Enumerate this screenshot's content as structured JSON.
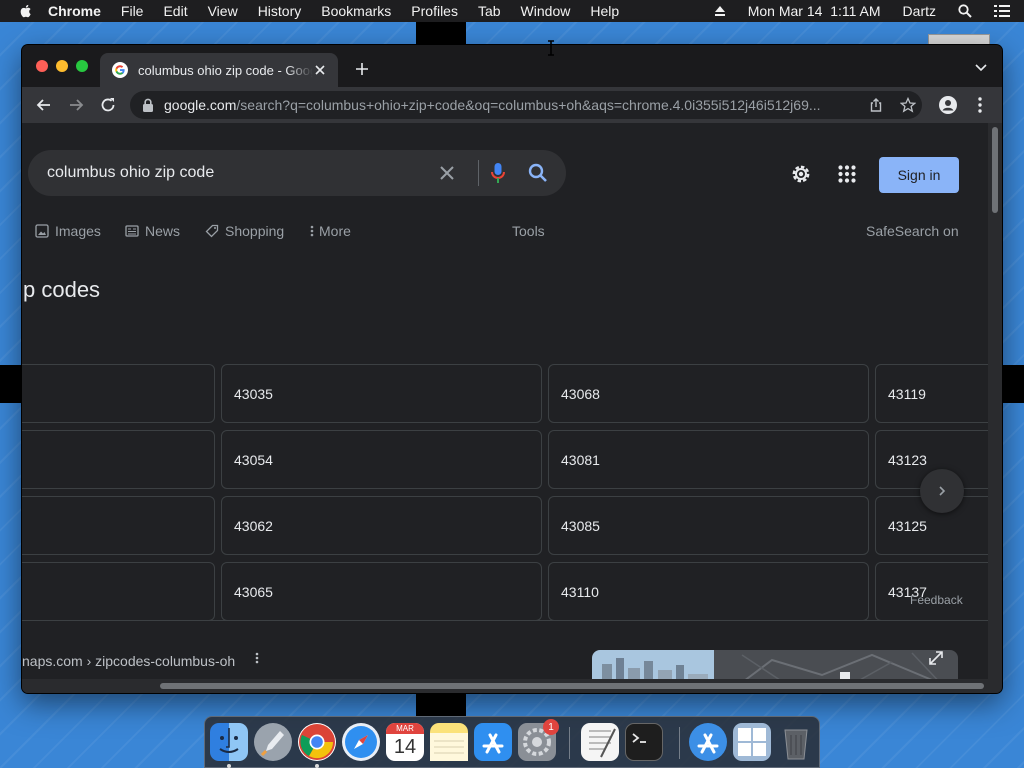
{
  "menubar": {
    "app": "Chrome",
    "items": [
      "File",
      "Edit",
      "View",
      "History",
      "Bookmarks",
      "Profiles",
      "Tab",
      "Window",
      "Help"
    ],
    "datetime": "Mon Mar 14  1:11 AM",
    "user": "Dartz",
    "icons": [
      "apple-icon",
      "eject-icon",
      "spotlight-search-icon",
      "control-center-icon"
    ]
  },
  "tab": {
    "title": "columbus ohio zip code - Google Search",
    "icons": [
      "google-favicon",
      "close-icon",
      "new-tab-icon",
      "tab-search-icon"
    ]
  },
  "toolbar": {
    "url_host": "google.com",
    "url_path": "/search?q=columbus+ohio+zip+code&oq=columbus+oh&aqs=chrome.4.0i355i512j46i512j69...",
    "icons": [
      "back-icon",
      "forward-icon",
      "reload-icon",
      "lock-icon",
      "share-icon",
      "bookmark-star-icon",
      "profile-icon",
      "menu-icon"
    ]
  },
  "search": {
    "query": "columbus ohio zip code",
    "icons": [
      "clear-icon",
      "voice-search-icon",
      "search-icon"
    ]
  },
  "header": {
    "sign_in": "Sign in",
    "icons": [
      "settings-icon",
      "apps-icon"
    ]
  },
  "nav": {
    "tabs": [
      "Images",
      "News",
      "Shopping",
      "More"
    ],
    "tools": "Tools",
    "safesearch": "SafeSearch on"
  },
  "results": {
    "heading": "p codes",
    "zip_columns": [
      [
        "",
        "",
        "",
        ""
      ],
      [
        "43035",
        "43054",
        "43062",
        "43065"
      ],
      [
        "43068",
        "43081",
        "43085",
        "43110"
      ],
      [
        "43119",
        "43123",
        "43125",
        "43137"
      ]
    ],
    "feedback": "Feedback",
    "cite": "naps.com › zipcodes-columbus-oh"
  },
  "dock": {
    "apps": [
      "Finder",
      "Launchpad",
      "Google Chrome",
      "Safari",
      "Calendar",
      "Notes",
      "App Store",
      "System Preferences",
      "TextEdit",
      "Terminal",
      "Downloads",
      "Boot Camp",
      "Trash"
    ],
    "calendar_month": "MAR",
    "calendar_day": "14",
    "settings_badge": "1"
  },
  "colors": {
    "page_bg": "#202124",
    "accent": "#8ab4f8",
    "text_primary": "#e8eaed",
    "text_secondary": "#9aa0a6"
  }
}
